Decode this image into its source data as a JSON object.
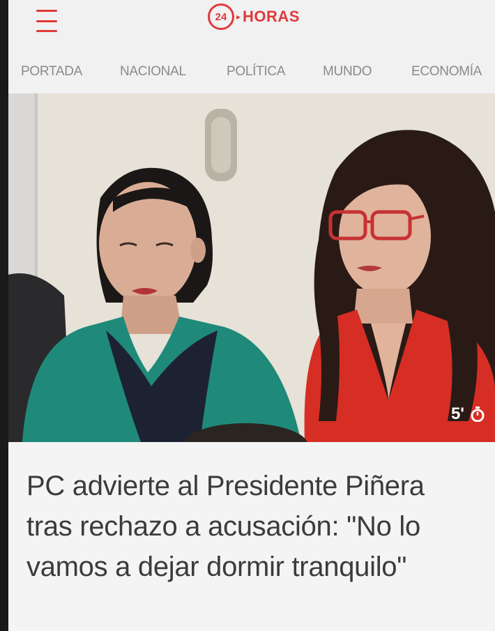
{
  "header": {
    "logo_number": "24",
    "logo_arrow": "▸",
    "logo_text": "HORAS",
    "menu_icon": "hamburger-icon",
    "brand_color": "#e0393a"
  },
  "nav": {
    "items": [
      {
        "label": "PORTADA"
      },
      {
        "label": "NACIONAL"
      },
      {
        "label": "POLÍTICA"
      },
      {
        "label": "MUNDO"
      },
      {
        "label": "ECONOMÍA"
      }
    ]
  },
  "article": {
    "duration": "5'",
    "duration_icon": "stopwatch-icon",
    "headline": "PC advierte al Presidente Piñera tras rechazo a acusación: \"No lo vamos a dejar dormir tranquilo\""
  }
}
